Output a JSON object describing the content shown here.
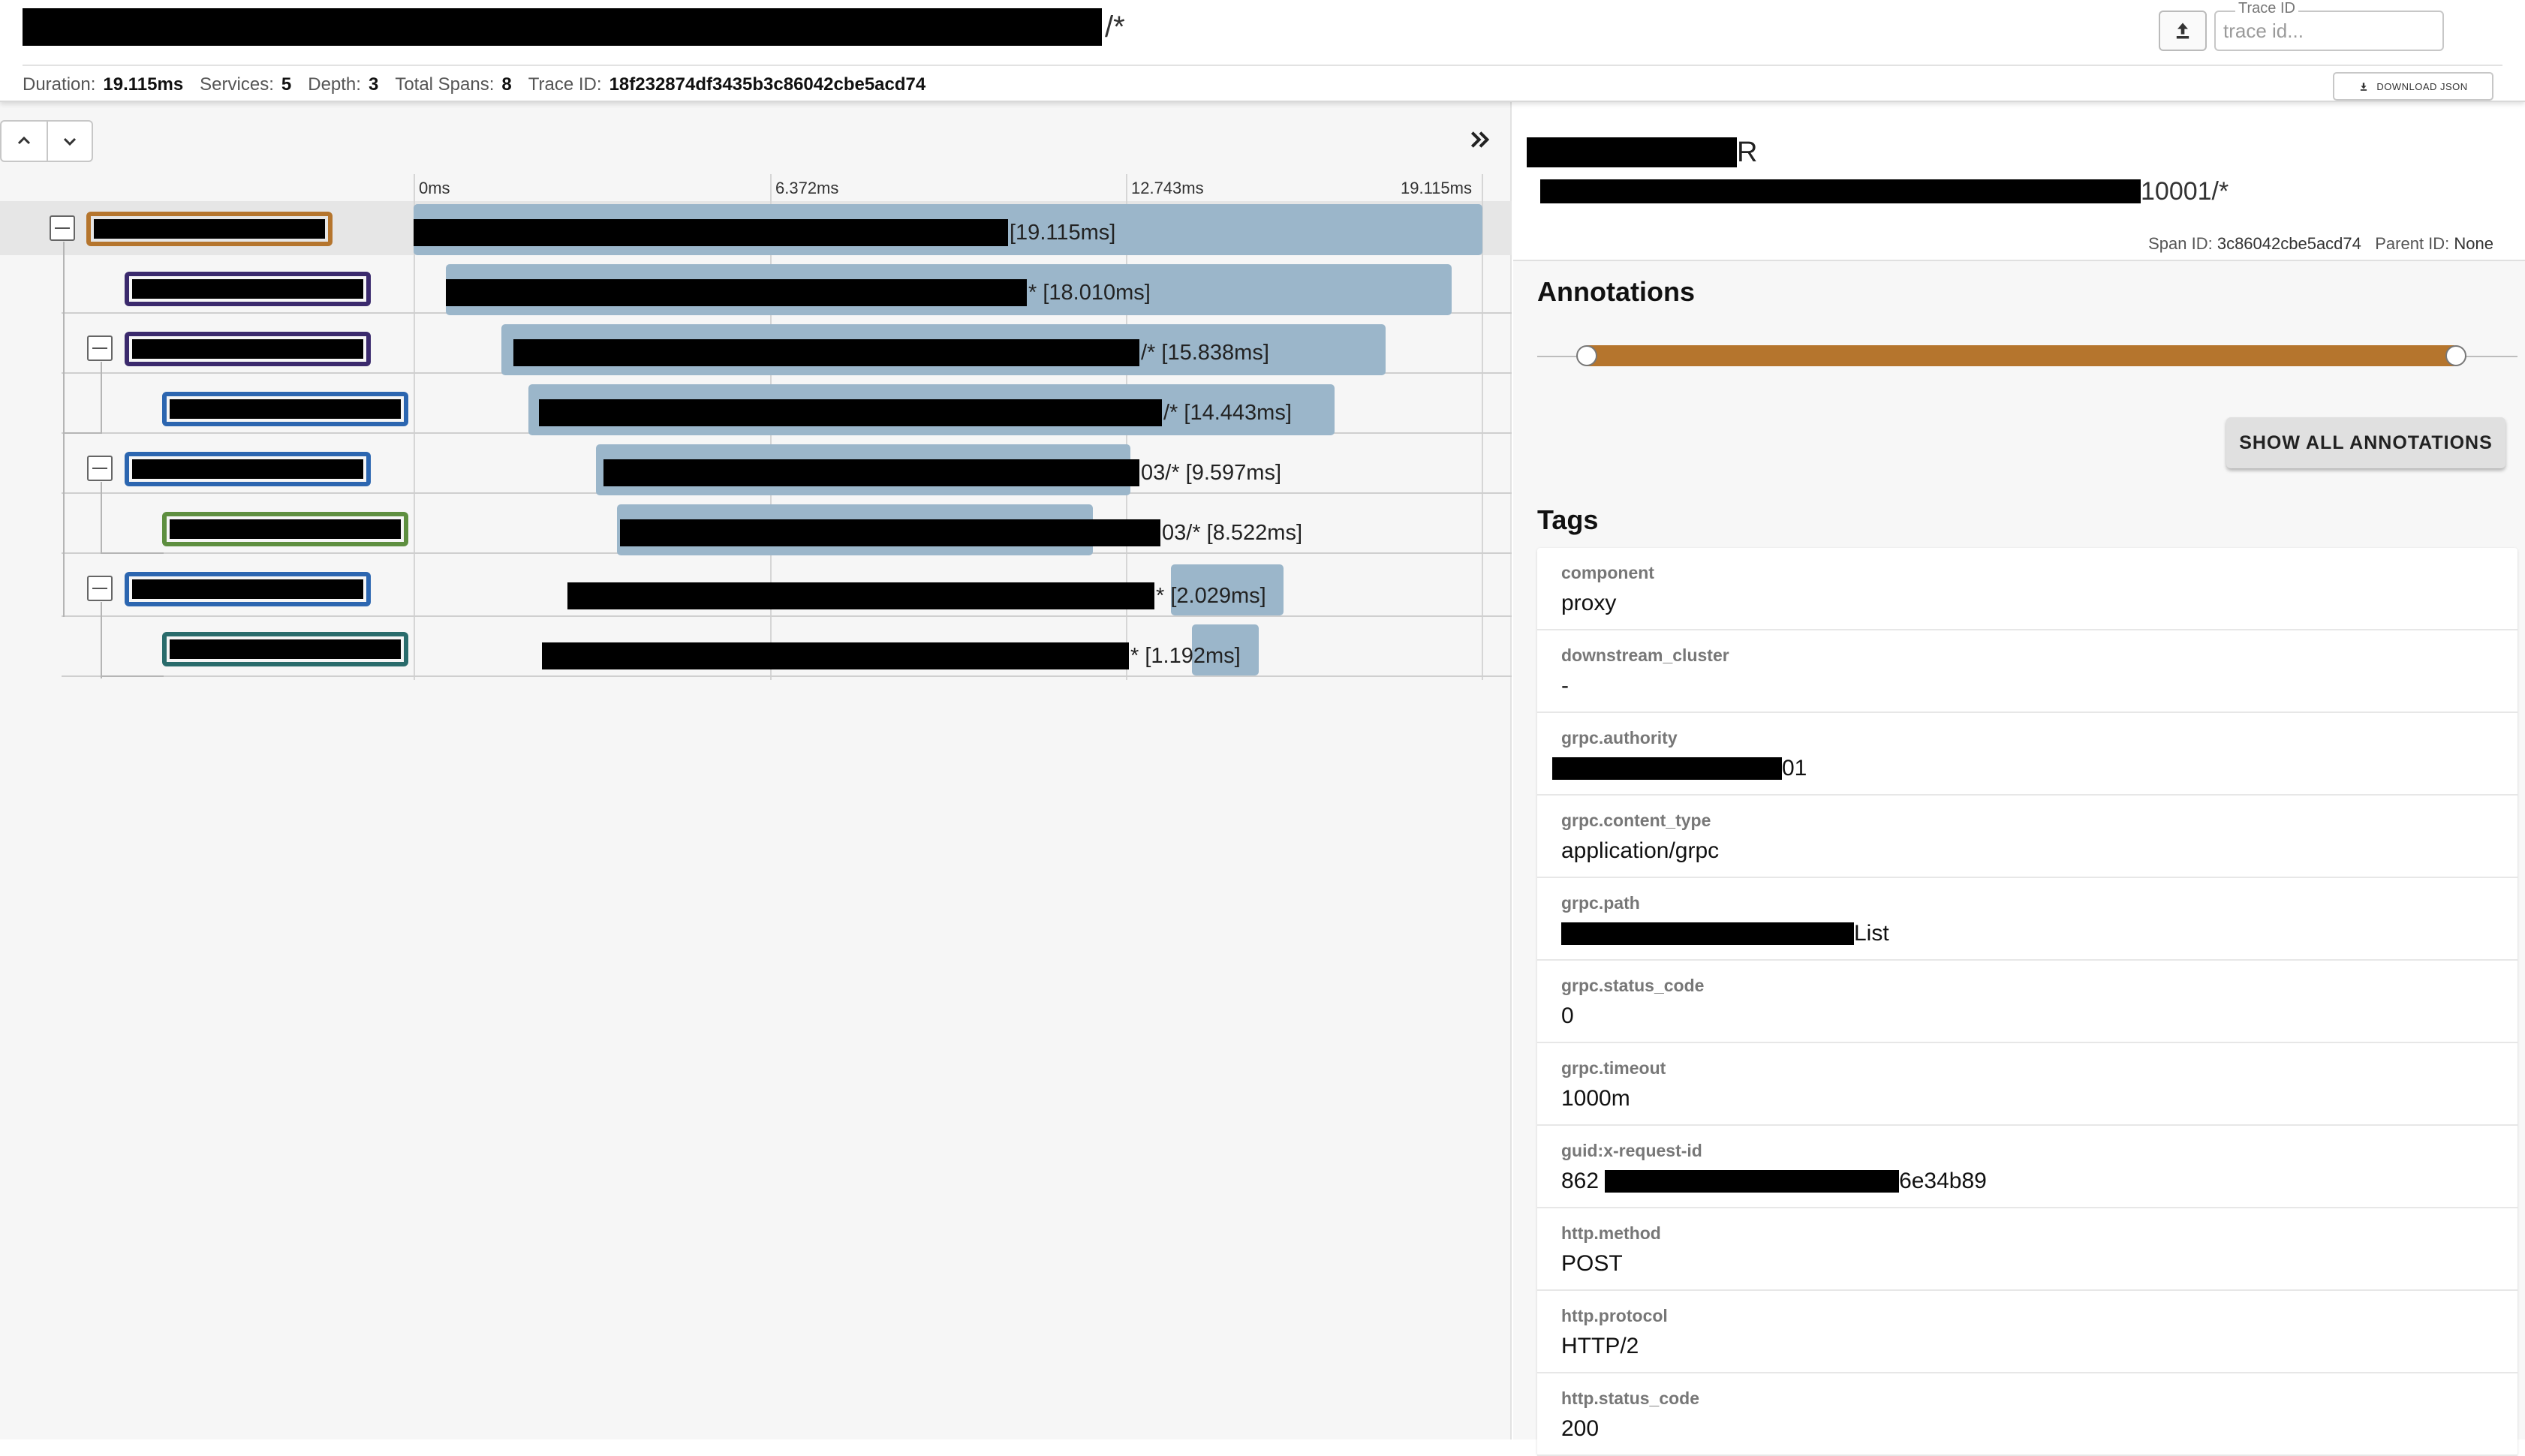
{
  "header": {
    "title_suffix": "/*",
    "trace_id_label": "Trace ID",
    "trace_id_placeholder": "trace id...",
    "download_label": "DOWNLOAD JSON",
    "summary": [
      {
        "label": "Duration:",
        "value": "19.115ms"
      },
      {
        "label": "Services:",
        "value": "5"
      },
      {
        "label": "Depth:",
        "value": "3"
      },
      {
        "label": "Total Spans:",
        "value": "8"
      },
      {
        "label": "Trace ID:",
        "value": "18f232874df3435b3c86042cbe5acd74"
      }
    ]
  },
  "timeline": {
    "ticks": [
      "0ms",
      "6.372ms",
      "12.743ms",
      "19.115ms"
    ],
    "spans": [
      {
        "suffix": "[19.115ms]",
        "service_color": "#b5752d",
        "duration_ms": 19.115
      },
      {
        "suffix": "* [18.010ms]",
        "service_color": "#3b2a6d",
        "duration_ms": 18.01
      },
      {
        "suffix": "/* [15.838ms]",
        "service_color": "#3b2a6d",
        "duration_ms": 15.838
      },
      {
        "suffix": "/* [14.443ms]",
        "service_color": "#2c66b0",
        "duration_ms": 14.443
      },
      {
        "suffix": "03/* [9.597ms]",
        "service_color": "#2c66b0",
        "duration_ms": 9.597
      },
      {
        "suffix": "03/* [8.522ms]",
        "service_color": "#5e8f40",
        "duration_ms": 8.522
      },
      {
        "suffix": "* [2.029ms]",
        "service_color": "#2c66b0",
        "duration_ms": 2.029
      },
      {
        "suffix": "* [1.192ms]",
        "service_color": "#2a6c6c",
        "duration_ms": 1.192
      }
    ]
  },
  "span_detail": {
    "name_suffix": "R",
    "path_suffix": "10001/*",
    "span_id_label": "Span ID:",
    "span_id": "3c86042cbe5acd74",
    "parent_id_label": "Parent ID:",
    "parent_id": "None",
    "annotations_title": "Annotations",
    "show_annotations_label": "SHOW ALL ANNOTATIONS",
    "tags_title": "Tags",
    "tags": [
      {
        "key": "component",
        "value": "proxy"
      },
      {
        "key": "downstream_cluster",
        "value": "-"
      },
      {
        "key": "grpc.authority",
        "prefix": "",
        "value": "01"
      },
      {
        "key": "grpc.content_type",
        "value": "application/grpc"
      },
      {
        "key": "grpc.path",
        "prefix": "",
        "value": "List"
      },
      {
        "key": "grpc.status_code",
        "value": "0"
      },
      {
        "key": "grpc.timeout",
        "value": "1000m"
      },
      {
        "key": "guid:x-request-id",
        "prefix": "862",
        "value": "6e34b89"
      },
      {
        "key": "http.method",
        "value": "POST"
      },
      {
        "key": "http.protocol",
        "value": "HTTP/2"
      },
      {
        "key": "http.status_code",
        "value": "200"
      }
    ]
  },
  "colors": {
    "span_bar": "#9bb6ca",
    "annotation_range": "#b5752d"
  }
}
